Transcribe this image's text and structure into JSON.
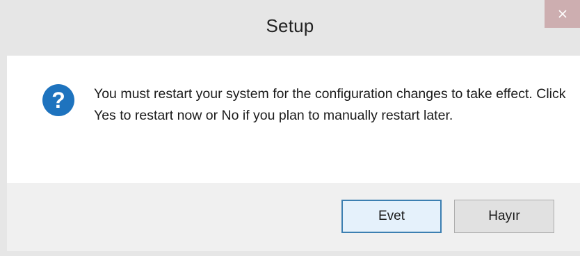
{
  "window": {
    "title": "Setup",
    "close_icon": "close-icon"
  },
  "dialog": {
    "icon": "question-icon",
    "icon_glyph": "?",
    "message": "You must restart your system for the configuration changes to take effect. Click Yes to restart now or No if you plan to manually restart later."
  },
  "buttons": {
    "yes_label": "Evet",
    "no_label": "Hayır"
  },
  "colors": {
    "icon_blue": "#1e73be",
    "close_bg": "#cdaeb0",
    "default_button_border": "#3c7fb1"
  }
}
